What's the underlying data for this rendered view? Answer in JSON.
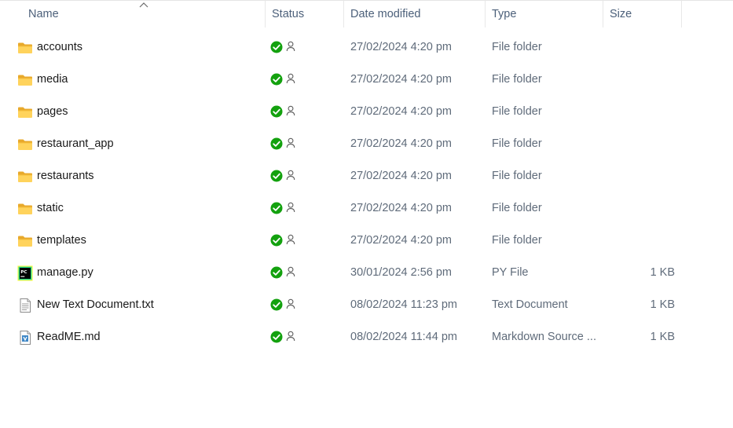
{
  "columns": {
    "name": "Name",
    "status": "Status",
    "date_modified": "Date modified",
    "type": "Type",
    "size": "Size"
  },
  "sort": {
    "column": "name",
    "direction": "ascending",
    "icon": "chevron-up-icon"
  },
  "status_icons": {
    "synced": "check-circle-icon",
    "shared": "person-icon",
    "synced_color": "#13a10e"
  },
  "rows": [
    {
      "name": "accounts",
      "icon": "folder-icon",
      "date": "27/02/2024 4:20 pm",
      "type": "File folder",
      "size": ""
    },
    {
      "name": "media",
      "icon": "folder-icon",
      "date": "27/02/2024 4:20 pm",
      "type": "File folder",
      "size": ""
    },
    {
      "name": "pages",
      "icon": "folder-icon",
      "date": "27/02/2024 4:20 pm",
      "type": "File folder",
      "size": ""
    },
    {
      "name": "restaurant_app",
      "icon": "folder-icon",
      "date": "27/02/2024 4:20 pm",
      "type": "File folder",
      "size": ""
    },
    {
      "name": "restaurants",
      "icon": "folder-icon",
      "date": "27/02/2024 4:20 pm",
      "type": "File folder",
      "size": ""
    },
    {
      "name": "static",
      "icon": "folder-icon",
      "date": "27/02/2024 4:20 pm",
      "type": "File folder",
      "size": ""
    },
    {
      "name": "templates",
      "icon": "folder-icon",
      "date": "27/02/2024 4:20 pm",
      "type": "File folder",
      "size": ""
    },
    {
      "name": "manage.py",
      "icon": "pycharm-file-icon",
      "date": "30/01/2024 2:56 pm",
      "type": "PY File",
      "size": "1 KB"
    },
    {
      "name": "New Text Document.txt",
      "icon": "text-file-icon",
      "date": "08/02/2024 11:23 pm",
      "type": "Text Document",
      "size": "1 KB"
    },
    {
      "name": "ReadME.md",
      "icon": "markdown-file-icon",
      "date": "08/02/2024 11:44 pm",
      "type": "Markdown Source ...",
      "size": "1 KB"
    }
  ]
}
